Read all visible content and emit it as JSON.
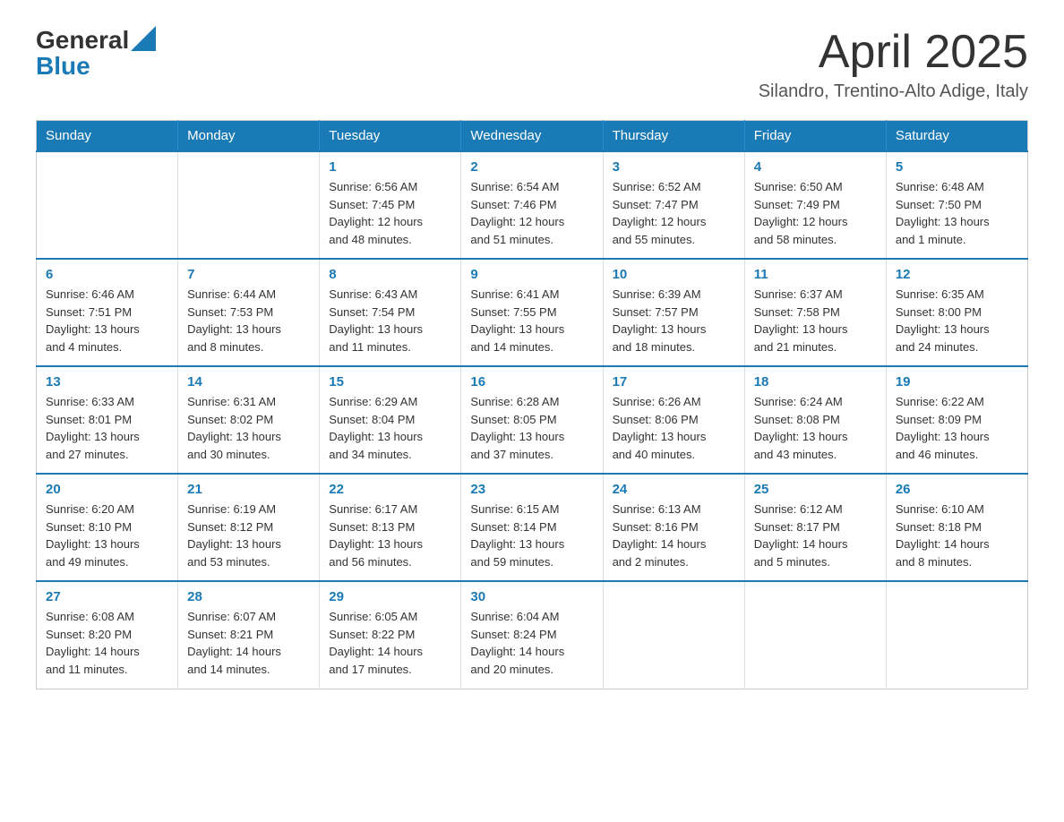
{
  "header": {
    "logo": {
      "general": "General",
      "blue": "Blue"
    },
    "title": "April 2025",
    "subtitle": "Silandro, Trentino-Alto Adige, Italy"
  },
  "calendar": {
    "headers": [
      "Sunday",
      "Monday",
      "Tuesday",
      "Wednesday",
      "Thursday",
      "Friday",
      "Saturday"
    ],
    "weeks": [
      [
        {
          "day": "",
          "info": ""
        },
        {
          "day": "",
          "info": ""
        },
        {
          "day": "1",
          "info": "Sunrise: 6:56 AM\nSunset: 7:45 PM\nDaylight: 12 hours\nand 48 minutes."
        },
        {
          "day": "2",
          "info": "Sunrise: 6:54 AM\nSunset: 7:46 PM\nDaylight: 12 hours\nand 51 minutes."
        },
        {
          "day": "3",
          "info": "Sunrise: 6:52 AM\nSunset: 7:47 PM\nDaylight: 12 hours\nand 55 minutes."
        },
        {
          "day": "4",
          "info": "Sunrise: 6:50 AM\nSunset: 7:49 PM\nDaylight: 12 hours\nand 58 minutes."
        },
        {
          "day": "5",
          "info": "Sunrise: 6:48 AM\nSunset: 7:50 PM\nDaylight: 13 hours\nand 1 minute."
        }
      ],
      [
        {
          "day": "6",
          "info": "Sunrise: 6:46 AM\nSunset: 7:51 PM\nDaylight: 13 hours\nand 4 minutes."
        },
        {
          "day": "7",
          "info": "Sunrise: 6:44 AM\nSunset: 7:53 PM\nDaylight: 13 hours\nand 8 minutes."
        },
        {
          "day": "8",
          "info": "Sunrise: 6:43 AM\nSunset: 7:54 PM\nDaylight: 13 hours\nand 11 minutes."
        },
        {
          "day": "9",
          "info": "Sunrise: 6:41 AM\nSunset: 7:55 PM\nDaylight: 13 hours\nand 14 minutes."
        },
        {
          "day": "10",
          "info": "Sunrise: 6:39 AM\nSunset: 7:57 PM\nDaylight: 13 hours\nand 18 minutes."
        },
        {
          "day": "11",
          "info": "Sunrise: 6:37 AM\nSunset: 7:58 PM\nDaylight: 13 hours\nand 21 minutes."
        },
        {
          "day": "12",
          "info": "Sunrise: 6:35 AM\nSunset: 8:00 PM\nDaylight: 13 hours\nand 24 minutes."
        }
      ],
      [
        {
          "day": "13",
          "info": "Sunrise: 6:33 AM\nSunset: 8:01 PM\nDaylight: 13 hours\nand 27 minutes."
        },
        {
          "day": "14",
          "info": "Sunrise: 6:31 AM\nSunset: 8:02 PM\nDaylight: 13 hours\nand 30 minutes."
        },
        {
          "day": "15",
          "info": "Sunrise: 6:29 AM\nSunset: 8:04 PM\nDaylight: 13 hours\nand 34 minutes."
        },
        {
          "day": "16",
          "info": "Sunrise: 6:28 AM\nSunset: 8:05 PM\nDaylight: 13 hours\nand 37 minutes."
        },
        {
          "day": "17",
          "info": "Sunrise: 6:26 AM\nSunset: 8:06 PM\nDaylight: 13 hours\nand 40 minutes."
        },
        {
          "day": "18",
          "info": "Sunrise: 6:24 AM\nSunset: 8:08 PM\nDaylight: 13 hours\nand 43 minutes."
        },
        {
          "day": "19",
          "info": "Sunrise: 6:22 AM\nSunset: 8:09 PM\nDaylight: 13 hours\nand 46 minutes."
        }
      ],
      [
        {
          "day": "20",
          "info": "Sunrise: 6:20 AM\nSunset: 8:10 PM\nDaylight: 13 hours\nand 49 minutes."
        },
        {
          "day": "21",
          "info": "Sunrise: 6:19 AM\nSunset: 8:12 PM\nDaylight: 13 hours\nand 53 minutes."
        },
        {
          "day": "22",
          "info": "Sunrise: 6:17 AM\nSunset: 8:13 PM\nDaylight: 13 hours\nand 56 minutes."
        },
        {
          "day": "23",
          "info": "Sunrise: 6:15 AM\nSunset: 8:14 PM\nDaylight: 13 hours\nand 59 minutes."
        },
        {
          "day": "24",
          "info": "Sunrise: 6:13 AM\nSunset: 8:16 PM\nDaylight: 14 hours\nand 2 minutes."
        },
        {
          "day": "25",
          "info": "Sunrise: 6:12 AM\nSunset: 8:17 PM\nDaylight: 14 hours\nand 5 minutes."
        },
        {
          "day": "26",
          "info": "Sunrise: 6:10 AM\nSunset: 8:18 PM\nDaylight: 14 hours\nand 8 minutes."
        }
      ],
      [
        {
          "day": "27",
          "info": "Sunrise: 6:08 AM\nSunset: 8:20 PM\nDaylight: 14 hours\nand 11 minutes."
        },
        {
          "day": "28",
          "info": "Sunrise: 6:07 AM\nSunset: 8:21 PM\nDaylight: 14 hours\nand 14 minutes."
        },
        {
          "day": "29",
          "info": "Sunrise: 6:05 AM\nSunset: 8:22 PM\nDaylight: 14 hours\nand 17 minutes."
        },
        {
          "day": "30",
          "info": "Sunrise: 6:04 AM\nSunset: 8:24 PM\nDaylight: 14 hours\nand 20 minutes."
        },
        {
          "day": "",
          "info": ""
        },
        {
          "day": "",
          "info": ""
        },
        {
          "day": "",
          "info": ""
        }
      ]
    ]
  }
}
